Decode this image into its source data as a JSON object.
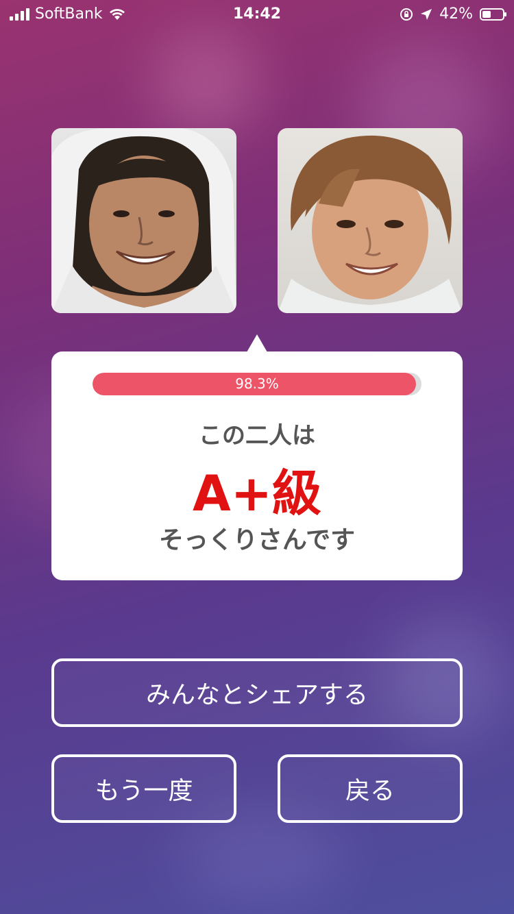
{
  "status_bar": {
    "carrier": "SoftBank",
    "time": "14:42",
    "battery": "42%",
    "battery_level": 0.42,
    "icons": [
      "signal-icon",
      "wifi-icon",
      "orientation-lock-icon",
      "location-arrow-icon",
      "battery-icon"
    ]
  },
  "photos": {
    "left": "face-photo-left",
    "right": "face-photo-right"
  },
  "result": {
    "similarity_label": "98.3%",
    "similarity_value": 98.3,
    "line1": "この二人は",
    "grade": "A+級",
    "line3": "そっくりさんです"
  },
  "buttons": {
    "share": "みんなとシェアする",
    "retry": "もう一度",
    "back": "戻る"
  },
  "colors": {
    "accent": "#ee5468",
    "grade": "#e01212"
  }
}
